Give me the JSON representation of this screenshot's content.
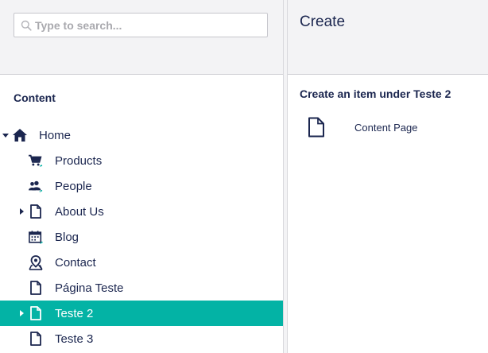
{
  "search": {
    "placeholder": "Type to search..."
  },
  "tree": {
    "title": "Content",
    "nodes": [
      {
        "label": "Home",
        "icon": "home-icon",
        "has_children": true,
        "expanded": true,
        "level": 0,
        "selected": false
      },
      {
        "label": "Products",
        "icon": "cart-icon",
        "has_children": false,
        "level": 1,
        "selected": false
      },
      {
        "label": "People",
        "icon": "users-icon",
        "has_children": false,
        "level": 1,
        "selected": false
      },
      {
        "label": "About Us",
        "icon": "document-icon",
        "has_children": true,
        "expanded": false,
        "level": 1,
        "selected": false
      },
      {
        "label": "Blog",
        "icon": "calendar-icon",
        "has_children": false,
        "level": 1,
        "selected": false
      },
      {
        "label": "Contact",
        "icon": "map-pin-icon",
        "has_children": false,
        "level": 1,
        "selected": false
      },
      {
        "label": "Página Teste",
        "icon": "document-icon",
        "has_children": false,
        "level": 1,
        "selected": false
      },
      {
        "label": "Teste 2",
        "icon": "document-icon",
        "has_children": true,
        "expanded": false,
        "level": 1,
        "selected": true
      },
      {
        "label": "Teste 3",
        "icon": "document-icon",
        "has_children": false,
        "level": 1,
        "selected": false
      }
    ]
  },
  "panel": {
    "title": "Create",
    "heading": "Create an item under Teste 2",
    "doc_types": [
      {
        "label": "Content Page",
        "icon": "document-icon"
      }
    ]
  },
  "colors": {
    "accent": "#03b3a5",
    "text": "#1b264f",
    "header_bg": "#f3f3f5"
  }
}
